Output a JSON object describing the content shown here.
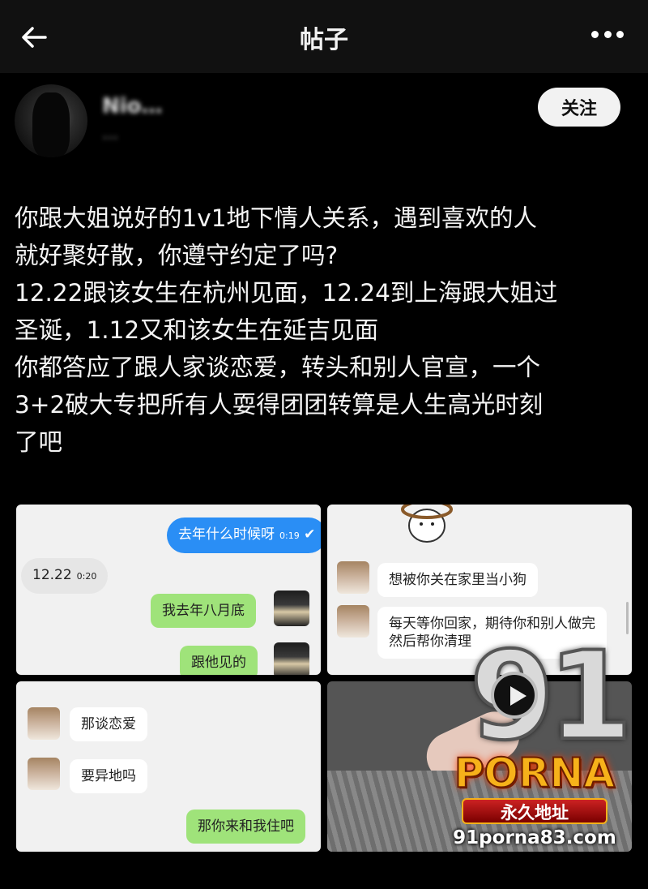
{
  "header": {
    "title": "帖子",
    "back_icon": "arrow-left-icon",
    "more_icon": "more-horizontal-icon"
  },
  "author": {
    "name": "Nio…",
    "handle": "…",
    "follow_label": "关注"
  },
  "post": {
    "text": "你跟大姐说好的1v1地下情人关系，遇到喜欢的人\n就好聚好散，你遵守约定了吗?\n12.22跟该女生在杭州见面，12.24到上海跟大姐过\n圣诞，1.12又和该女生在延吉见面\n你都答应了跟人家谈恋爱，转头和别人官宣，一个\n3+2破大专把所有人耍得团团转算是人生高光时刻\n了吧"
  },
  "screenshots": {
    "chat1": {
      "q": "去年什么时候呀",
      "q_time": "0:19",
      "a": "12.22",
      "a_time": "0:20",
      "r1": "我去年八月底",
      "r2": "跟他见的"
    },
    "chat2": {
      "m1": "想被你关在家里当小狗",
      "m2": "每天等你回家，期待你和别人做完\n然后帮你清理"
    },
    "chat3": {
      "m1": "那谈恋爱",
      "m2": "要异地吗",
      "r1": "那你来和我住吧"
    }
  },
  "watermark": {
    "brand_num": "91",
    "brand": "PORNA",
    "tag": "永久地址",
    "url": "91porna83.com"
  }
}
